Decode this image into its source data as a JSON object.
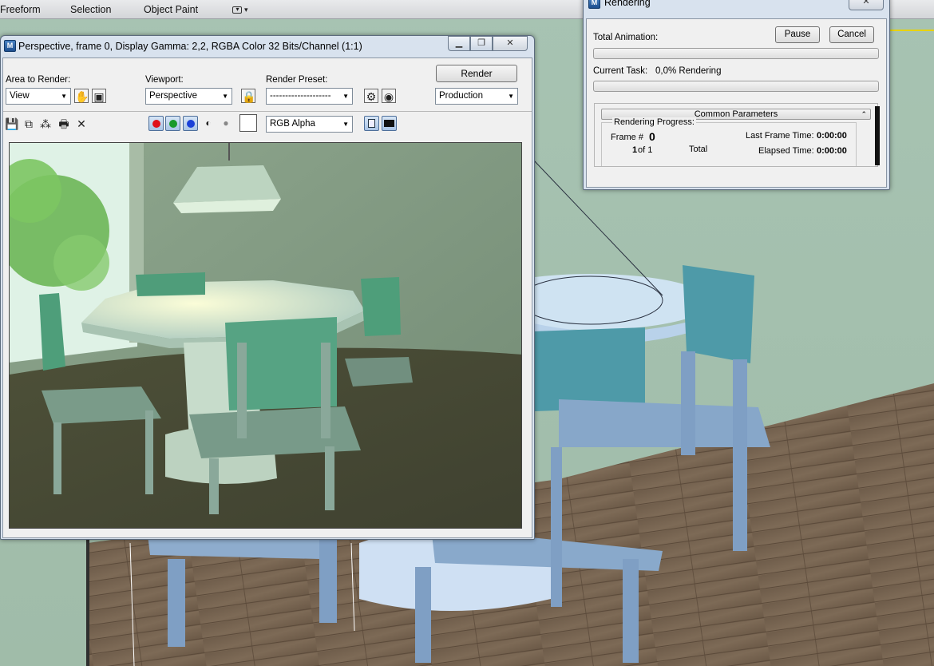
{
  "ribbon": {
    "tabs": [
      "Freeform",
      "Selection",
      "Object Paint"
    ],
    "dropdown_glyph": "▾"
  },
  "framebuffer": {
    "title": "Perspective, frame 0, Display Gamma: 2,2, RGBA Color 32 Bits/Channel (1:1)",
    "app_icon_text": "M",
    "area_label": "Area to Render:",
    "area_value": "View",
    "viewport_label": "Viewport:",
    "viewport_value": "Perspective",
    "preset_label": "Render Preset:",
    "preset_value": "--------------------",
    "render_button": "Render",
    "production_value": "Production",
    "channel_value": "RGB Alpha",
    "channel_colors": {
      "red": "#e0101a",
      "green": "#1a9a2a",
      "blue": "#1a40d8"
    }
  },
  "rendering": {
    "title": "Rendering",
    "app_icon_text": "M",
    "total_animation_label": "Total Animation:",
    "pause_button": "Pause",
    "cancel_button": "Cancel",
    "current_task_label": "Current Task:",
    "current_task_value": "0,0%  Rendering",
    "rollout_title": "Common Parameters",
    "progress_label": "Rendering Progress:",
    "frame_label": "Frame #",
    "frame_value": "0",
    "of_count_a": "1",
    "of_count_b": "of 1",
    "total_label": "Total",
    "last_frame_label": "Last Frame Time:",
    "last_frame_value": "0:00:00",
    "elapsed_label": "Elapsed Time:",
    "elapsed_value": "0:00:00"
  }
}
